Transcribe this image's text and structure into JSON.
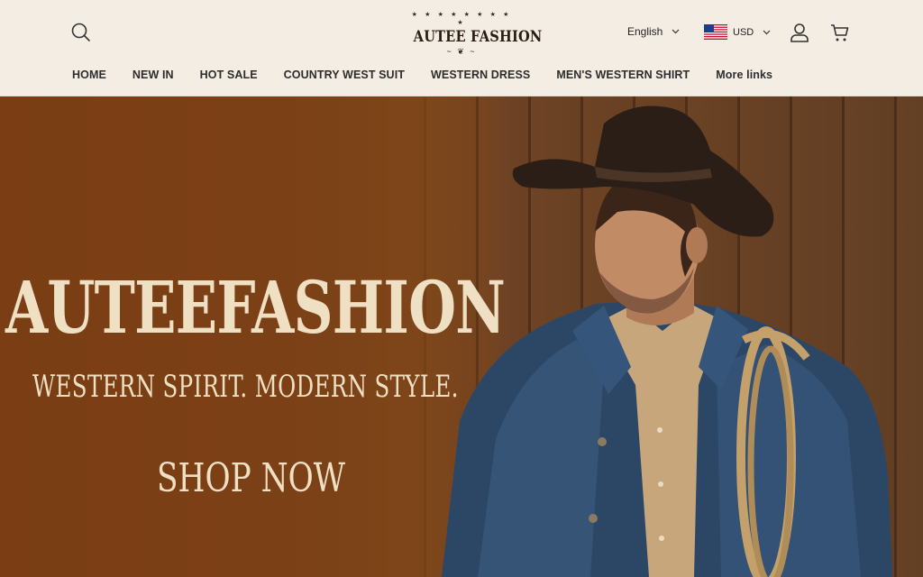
{
  "header": {
    "logo": {
      "stars": "★ ★ ★ ★ ★ ★ ★ ★ ★",
      "text": "AUTEE FASHION",
      "ornament": "~ ❦ ~"
    },
    "language": {
      "selected": "English"
    },
    "currency": {
      "selected": "USD",
      "flag": "us-flag-icon"
    },
    "icons": [
      "search-icon",
      "account-icon",
      "cart-icon"
    ]
  },
  "nav": {
    "items": [
      {
        "label": "HOME"
      },
      {
        "label": "NEW IN"
      },
      {
        "label": "HOT SALE"
      },
      {
        "label": "COUNTRY WEST SUIT"
      },
      {
        "label": "WESTERN DRESS"
      },
      {
        "label": "MEN'S WESTERN SHIRT"
      },
      {
        "label": "More links"
      }
    ]
  },
  "hero": {
    "title": "AUTEEFASHION",
    "subtitle": "WESTERN SPIRIT. MODERN STYLE.",
    "cta": "SHOP NOW"
  },
  "colors": {
    "header_bg": "#f4ede3",
    "hero_bg": "#7a3d14",
    "hero_text": "#efe0c4",
    "text": "#2d2d2d"
  }
}
